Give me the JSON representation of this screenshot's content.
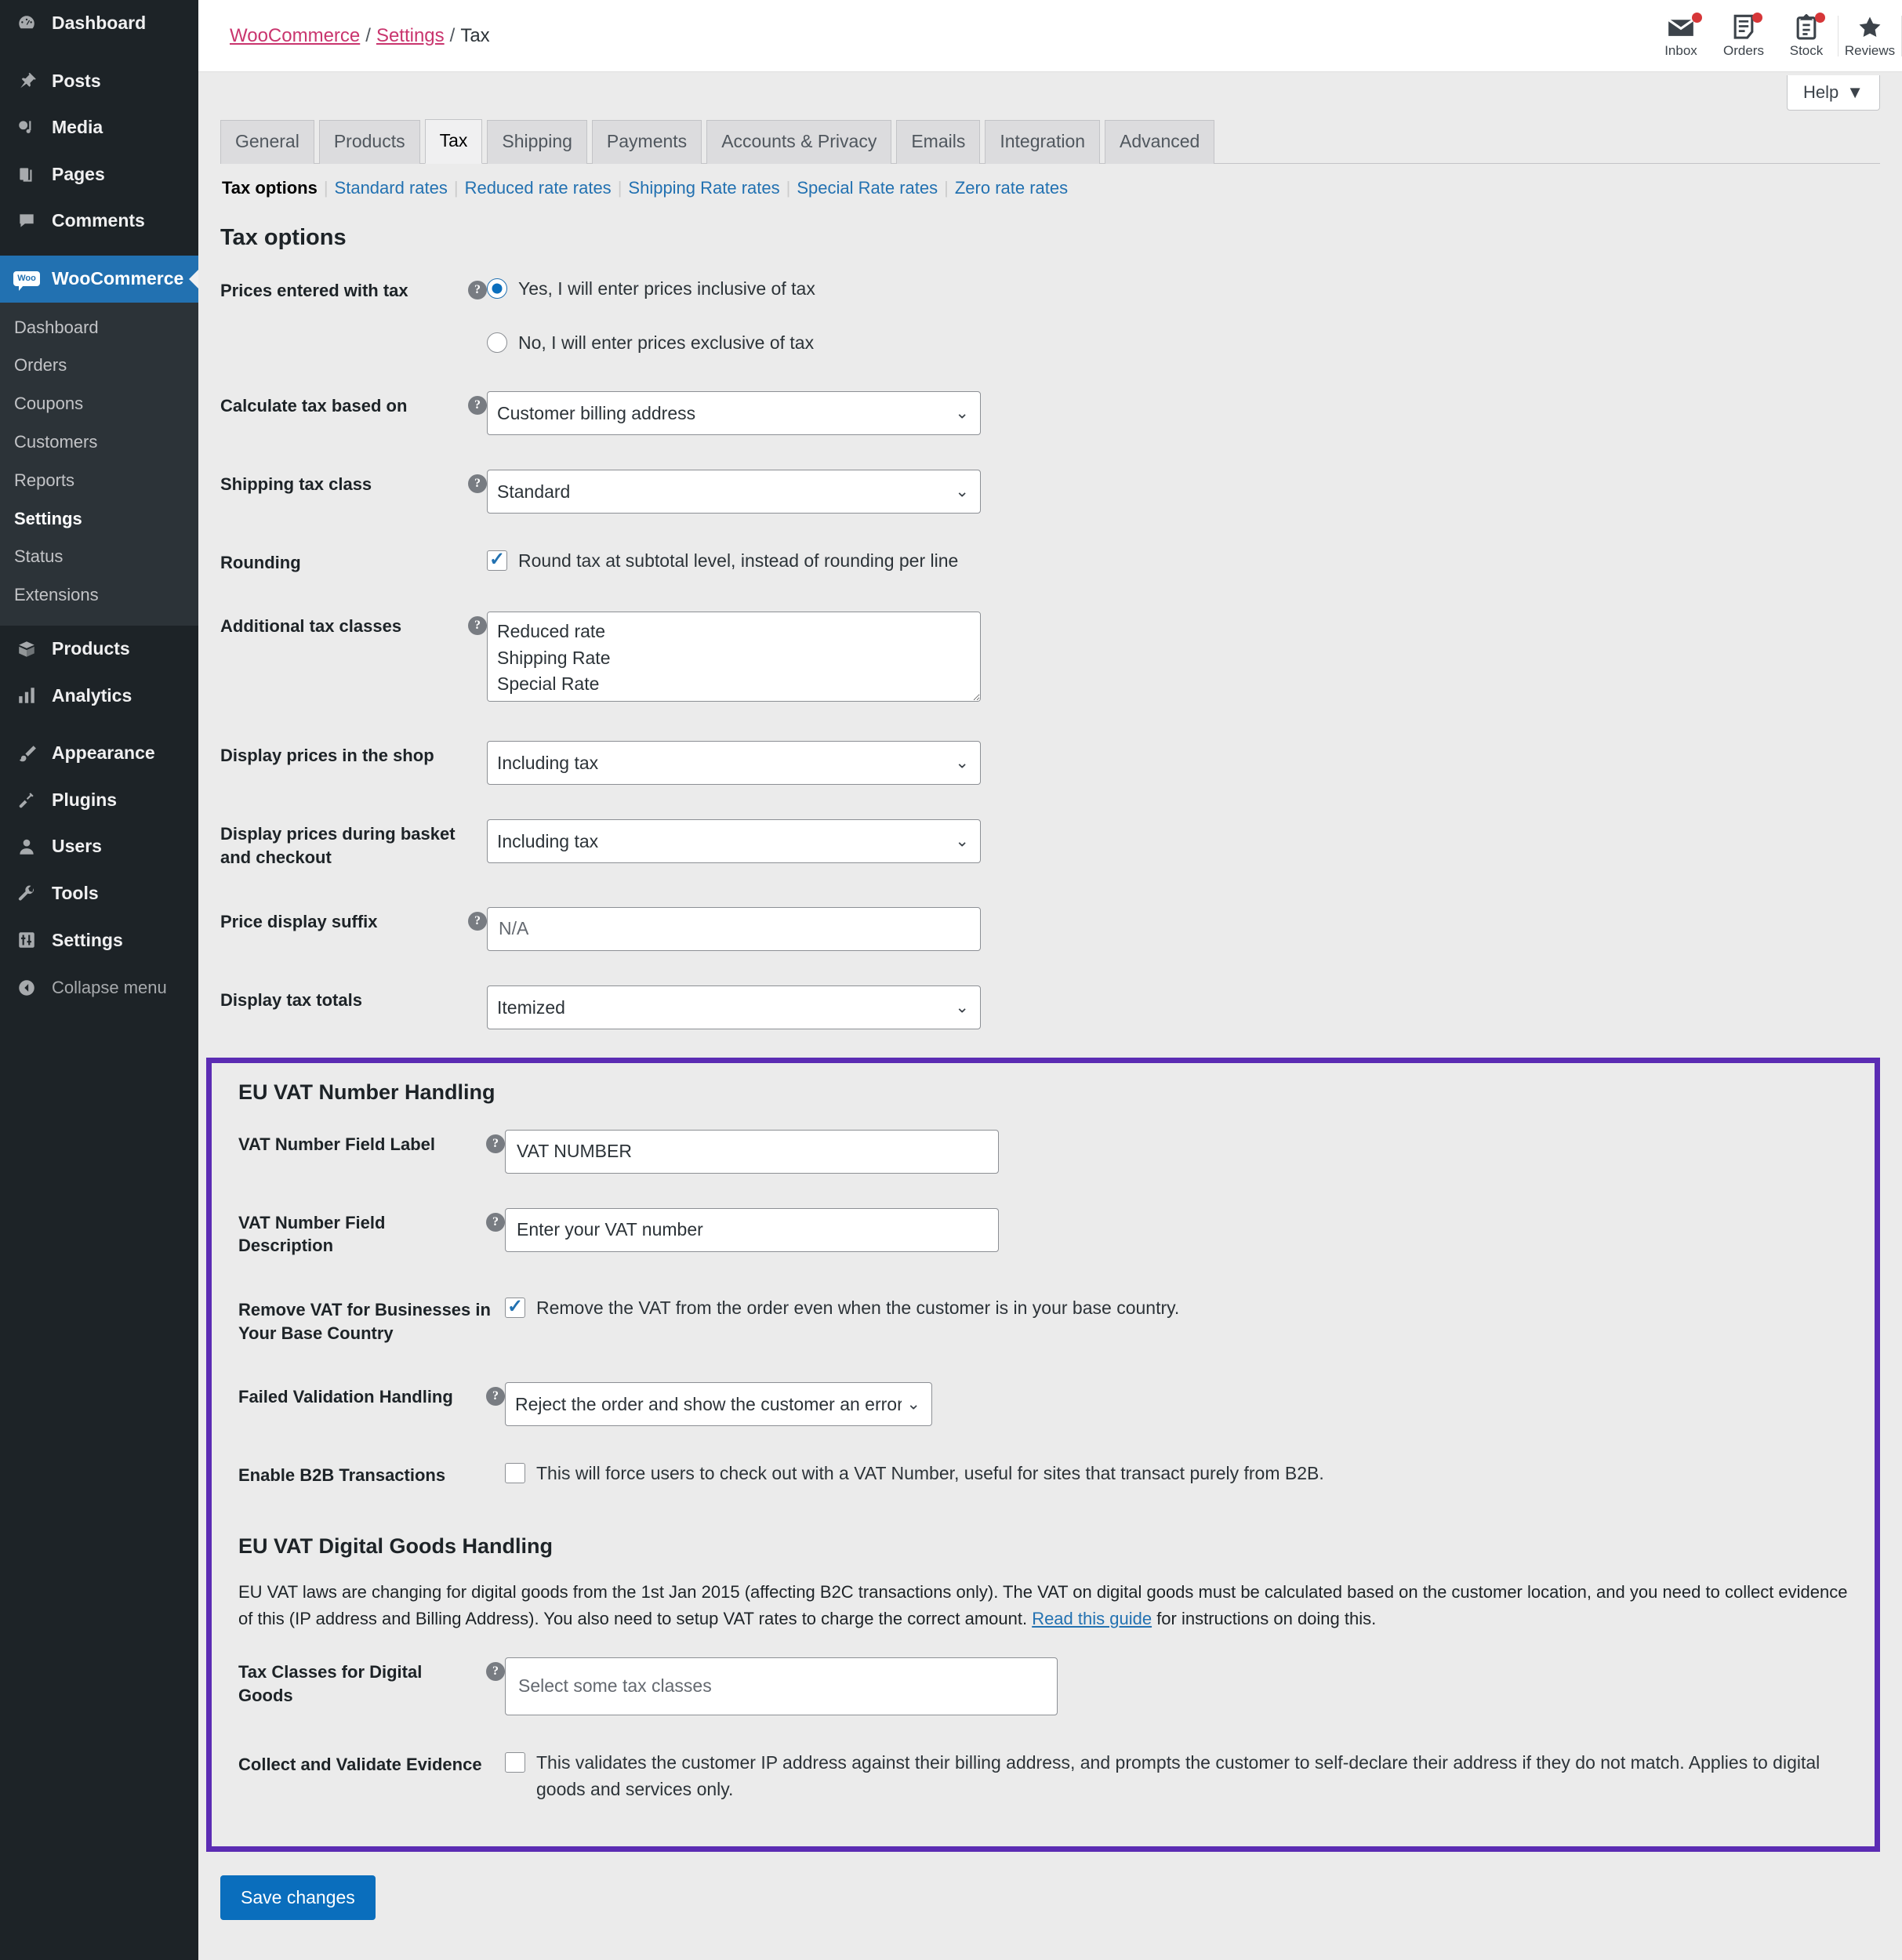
{
  "sidebar": {
    "top_items": [
      {
        "label": "Dashboard",
        "icon": "dashboard-icon"
      },
      {
        "label": "Posts",
        "icon": "pin-icon"
      },
      {
        "label": "Media",
        "icon": "media-icon"
      },
      {
        "label": "Pages",
        "icon": "pages-icon"
      },
      {
        "label": "Comments",
        "icon": "comments-icon"
      }
    ],
    "current_item": {
      "label": "WooCommerce",
      "icon": "woo-icon",
      "badge": "Woo"
    },
    "submenu": [
      {
        "label": "Dashboard",
        "current": false
      },
      {
        "label": "Orders",
        "current": false
      },
      {
        "label": "Coupons",
        "current": false
      },
      {
        "label": "Customers",
        "current": false
      },
      {
        "label": "Reports",
        "current": false
      },
      {
        "label": "Settings",
        "current": true
      },
      {
        "label": "Status",
        "current": false
      },
      {
        "label": "Extensions",
        "current": false
      }
    ],
    "lower_items": [
      {
        "label": "Products",
        "icon": "box-icon"
      },
      {
        "label": "Analytics",
        "icon": "bar-chart-icon"
      },
      {
        "label": "Appearance",
        "icon": "brush-icon"
      },
      {
        "label": "Plugins",
        "icon": "plug-icon"
      },
      {
        "label": "Users",
        "icon": "user-icon"
      },
      {
        "label": "Tools",
        "icon": "wrench-icon"
      },
      {
        "label": "Settings",
        "icon": "sliders-icon"
      }
    ],
    "collapse_label": "Collapse menu"
  },
  "header": {
    "breadcrumb": {
      "root": "WooCommerce",
      "parent": "Settings",
      "current": "Tax",
      "separator": "/"
    },
    "activity_icons": [
      {
        "label": "Inbox",
        "icon": "envelope-icon",
        "badge": true
      },
      {
        "label": "Orders",
        "icon": "document-icon",
        "badge": true
      },
      {
        "label": "Stock",
        "icon": "clipboard-icon",
        "badge": true
      },
      {
        "label": "Reviews",
        "icon": "star-icon",
        "badge": false
      }
    ],
    "help_label": "Help",
    "help_caret": "▼"
  },
  "tabs": [
    {
      "label": "General",
      "active": false
    },
    {
      "label": "Products",
      "active": false
    },
    {
      "label": "Tax",
      "active": true
    },
    {
      "label": "Shipping",
      "active": false
    },
    {
      "label": "Payments",
      "active": false
    },
    {
      "label": "Accounts & Privacy",
      "active": false
    },
    {
      "label": "Emails",
      "active": false
    },
    {
      "label": "Integration",
      "active": false
    },
    {
      "label": "Advanced",
      "active": false
    }
  ],
  "subnav": [
    {
      "label": "Tax options",
      "current": true
    },
    {
      "label": "Standard rates",
      "current": false
    },
    {
      "label": "Reduced rate rates",
      "current": false
    },
    {
      "label": "Shipping Rate rates",
      "current": false
    },
    {
      "label": "Special Rate rates",
      "current": false
    },
    {
      "label": "Zero rate rates",
      "current": false
    }
  ],
  "tax_options": {
    "heading": "Tax options",
    "prices_entered": {
      "label": "Prices entered with tax",
      "option_yes": "Yes, I will enter prices inclusive of tax",
      "option_no": "No, I will enter prices exclusive of tax",
      "selected": "yes"
    },
    "calculate_based_on": {
      "label": "Calculate tax based on",
      "value": "Customer billing address"
    },
    "shipping_tax_class": {
      "label": "Shipping tax class",
      "value": "Standard"
    },
    "rounding": {
      "label": "Rounding",
      "checkbox_text": "Round tax at subtotal level, instead of rounding per line",
      "checked": true
    },
    "additional_tax_classes": {
      "label": "Additional tax classes",
      "value": "Reduced rate\nShipping Rate\nSpecial Rate"
    },
    "display_prices_shop": {
      "label": "Display prices in the shop",
      "value": "Including tax"
    },
    "display_prices_checkout": {
      "label": "Display prices during basket and checkout",
      "value": "Including tax"
    },
    "price_display_suffix": {
      "label": "Price display suffix",
      "placeholder": "N/A",
      "value": ""
    },
    "display_tax_totals": {
      "label": "Display tax totals",
      "value": "Itemized"
    }
  },
  "eu_vat": {
    "heading": "EU VAT Number Handling",
    "field_label": {
      "label": "VAT Number Field Label",
      "value": "VAT NUMBER"
    },
    "field_description": {
      "label": "VAT Number Field Description",
      "value": "Enter your VAT number"
    },
    "remove_vat_base_country": {
      "label": "Remove VAT for Businesses in Your Base Country",
      "checkbox_text": "Remove the VAT from the order even when the customer is in your base country.",
      "checked": true
    },
    "failed_validation": {
      "label": "Failed Validation Handling",
      "value": "Reject the order and show the customer an error"
    },
    "b2b_transactions": {
      "label": "Enable B2B Transactions",
      "checkbox_text": "This will force users to check out with a VAT Number, useful for sites that transact purely from B2B.",
      "checked": false
    }
  },
  "eu_vat_digital": {
    "heading": "EU VAT Digital Goods Handling",
    "paragraph_part1": "EU VAT laws are changing for digital goods from the 1st Jan 2015 (affecting B2C transactions only). The VAT on digital goods must be calculated based on the customer location, and you need to collect evidence of this (IP address and Billing Address). You also need to setup VAT rates to charge the correct amount. ",
    "paragraph_link": "Read this guide",
    "paragraph_part2": " for instructions on doing this.",
    "tax_classes_digital": {
      "label": "Tax Classes for Digital Goods",
      "placeholder": "Select some tax classes"
    },
    "collect_validate": {
      "label": "Collect and Validate Evidence",
      "checkbox_text": "This validates the customer IP address against their billing address, and prompts the customer to self-declare their address if they do not match. Applies to digital goods and services only.",
      "checked": false
    }
  },
  "footer": {
    "save_label": "Save changes"
  },
  "colors": {
    "highlight_border": "#5b2cb3",
    "accent_blue": "#2271b1",
    "breadcrumb_link": "#c9356e",
    "badge_red": "#d63638",
    "sidebar_bg": "#1d2327"
  }
}
